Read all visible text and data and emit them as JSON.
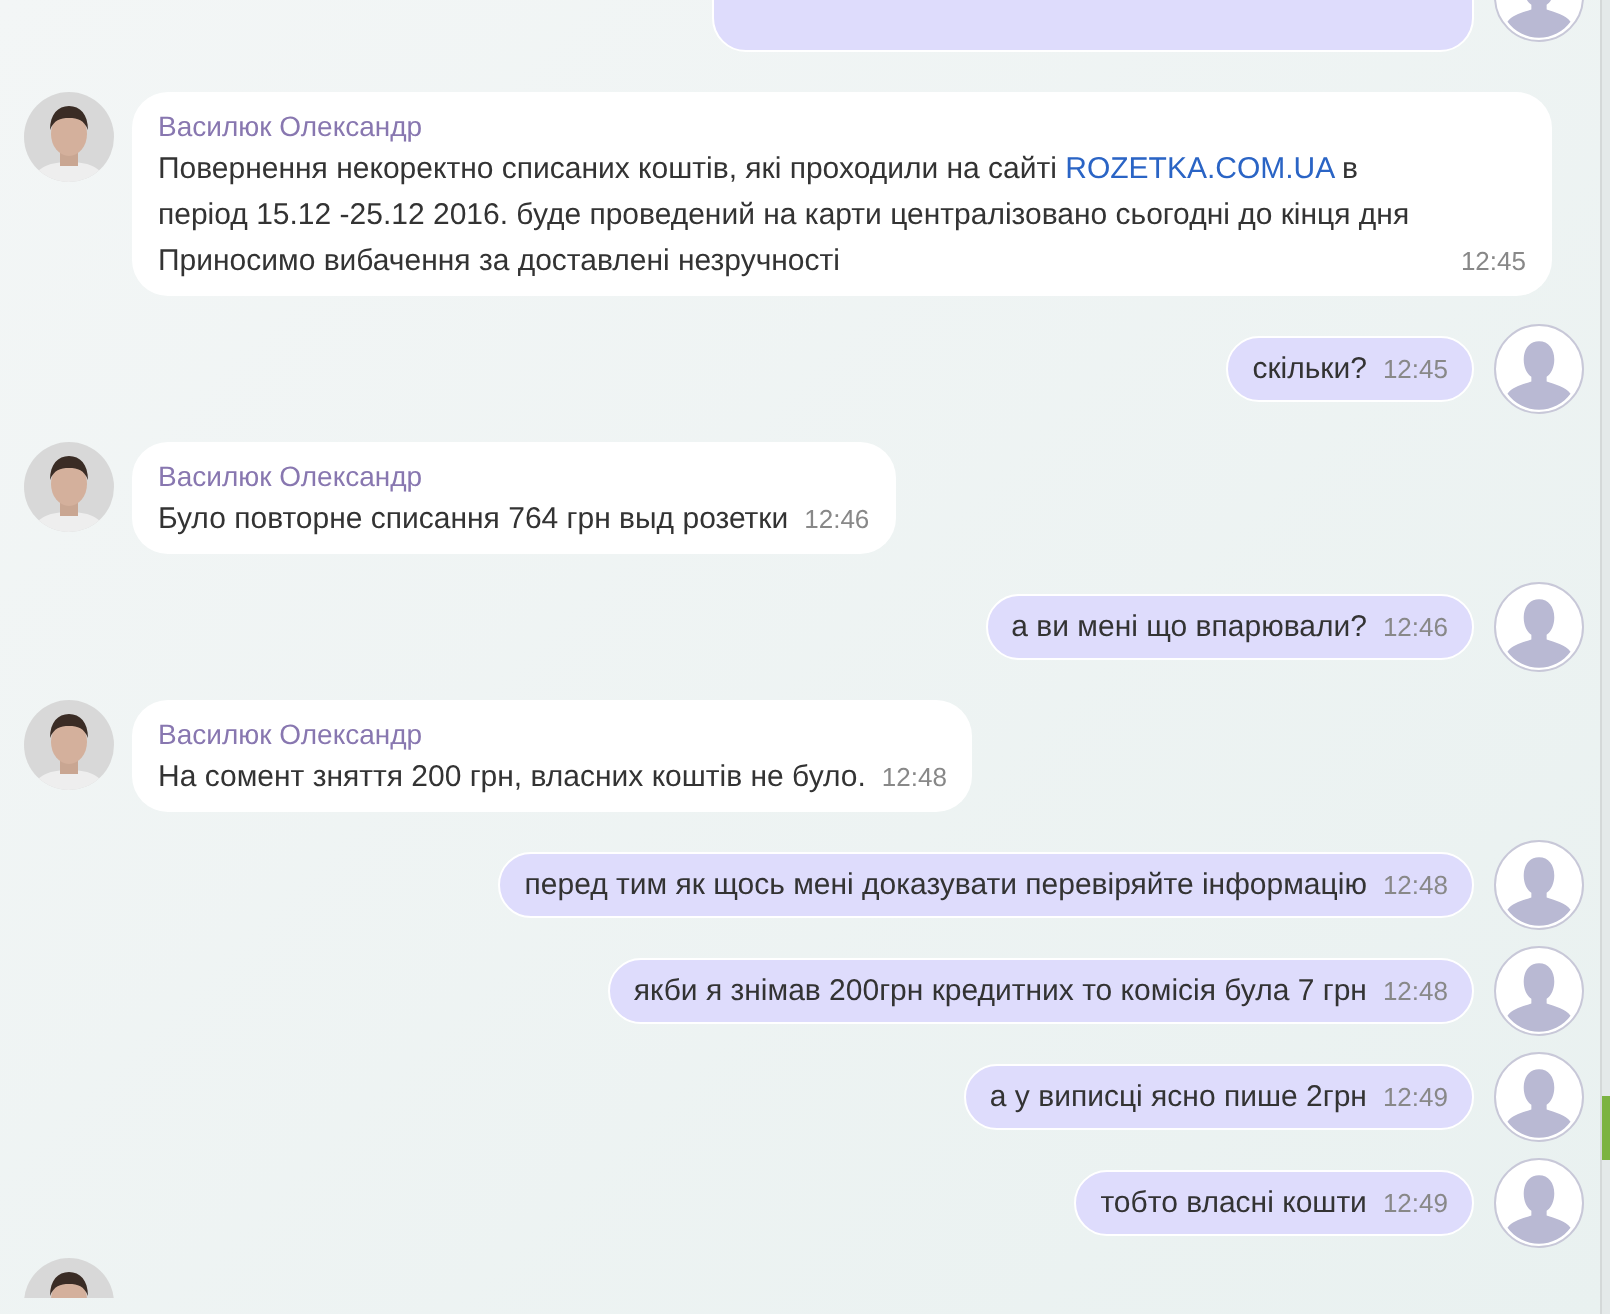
{
  "messages": [
    {
      "kind": "outgoing_cut"
    },
    {
      "kind": "incoming",
      "author": "Василюк Олександр",
      "parts": [
        {
          "kind": "plain",
          "text": "Повернення некоректно списаних коштів, які проходили на сайті "
        },
        {
          "kind": "link",
          "text": "ROZETKA.COM.UA"
        },
        {
          "kind": "plain",
          "text": " в період 15.12 -25.12 2016. буде проведений на карти централізовано сьогодні до кінця дня Приносимо вибачення за доставлені незручності"
        }
      ],
      "time": "12:45"
    },
    {
      "kind": "outgoing",
      "text": "скільки?",
      "time": "12:45"
    },
    {
      "kind": "incoming",
      "author": "Василюк Олександр",
      "parts": [
        {
          "kind": "plain",
          "text": "Було повторне списання 764 грн выд розетки"
        }
      ],
      "time": "12:46"
    },
    {
      "kind": "outgoing",
      "text": "а ви мені що впарювали?",
      "time": "12:46"
    },
    {
      "kind": "incoming",
      "author": "Василюк Олександр",
      "parts": [
        {
          "kind": "plain",
          "text": "На сомент зняття 200 грн, власних коштів не було."
        }
      ],
      "time": "12:48"
    },
    {
      "kind": "outgoing",
      "text": "перед тим як щось мені доказувати перевіряйте інформацію",
      "time": "12:48"
    },
    {
      "kind": "outgoing",
      "text": "якби я знімав 200грн кредитних то комісія була 7 грн",
      "time": "12:48"
    },
    {
      "kind": "outgoing",
      "text": "а у виписці ясно пише 2грн",
      "time": "12:49"
    },
    {
      "kind": "outgoing",
      "text": "тобто власні кошти",
      "time": "12:49"
    },
    {
      "kind": "incoming_avatar"
    }
  ]
}
